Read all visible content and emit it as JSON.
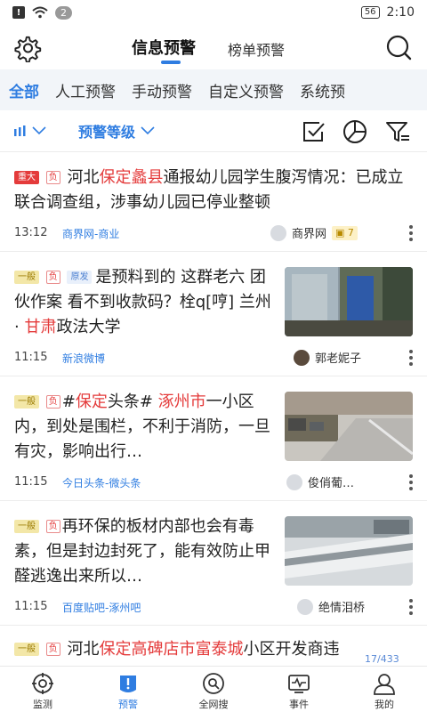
{
  "status_bar": {
    "badge_count": "2",
    "battery": "56",
    "time": "2:10"
  },
  "header": {
    "tab_main": "信息预警",
    "tab_sub": "榜单预警"
  },
  "categories": [
    "全部",
    "人工预警",
    "手动预警",
    "自定义预警",
    "系统预"
  ],
  "filters": {
    "level_label": "预警等级"
  },
  "items": [
    {
      "badge": "重大",
      "neg": "负",
      "title_parts": [
        "河北",
        "保定蠡县",
        "通报幼儿园学生腹泻情况：已成立联合调查组，涉事幼儿园已停业整顿"
      ],
      "time": "13:12",
      "source": "商界网-商业",
      "author": "商界网",
      "count": "7"
    },
    {
      "badge": "一般",
      "neg": "负",
      "orig": "原发",
      "title_parts": [
        "是预料到的 这群老六 团伙作案 看不到收款码？栓q[哼] 兰州 · ",
        "甘肃",
        "政法大学"
      ],
      "time": "11:15",
      "source": "新浪微博",
      "author": "郭老妮子"
    },
    {
      "badge": "一般",
      "neg": "负",
      "title_parts": [
        "#",
        "保定",
        "头条# ",
        "涿州市",
        "一小区内，到处是围栏，不利于消防，一旦有灾，影响出行…"
      ],
      "time": "11:15",
      "source": "今日头条-微头条",
      "author": "俊俏葡…"
    },
    {
      "badge": "一般",
      "neg": "负",
      "title_parts": [
        "再环保的板材内部也会有毒素，但是封边封死了，能有效防止甲醛逃逸出来所以…"
      ],
      "time": "11:15",
      "source": "百度贴吧-涿州吧",
      "author": "绝情泪桥"
    },
    {
      "badge": "一般",
      "neg": "负",
      "title_parts": [
        "河北",
        "保定高碑店市富泰城",
        "小区开发商违"
      ]
    }
  ],
  "counter": "17/433",
  "nav": [
    "监测",
    "预警",
    "全网搜",
    "事件",
    "我的"
  ],
  "colors": {
    "accent": "#2f7de1",
    "alert_red": "#e43b3b",
    "cat_bg": "#f2f5f9"
  }
}
